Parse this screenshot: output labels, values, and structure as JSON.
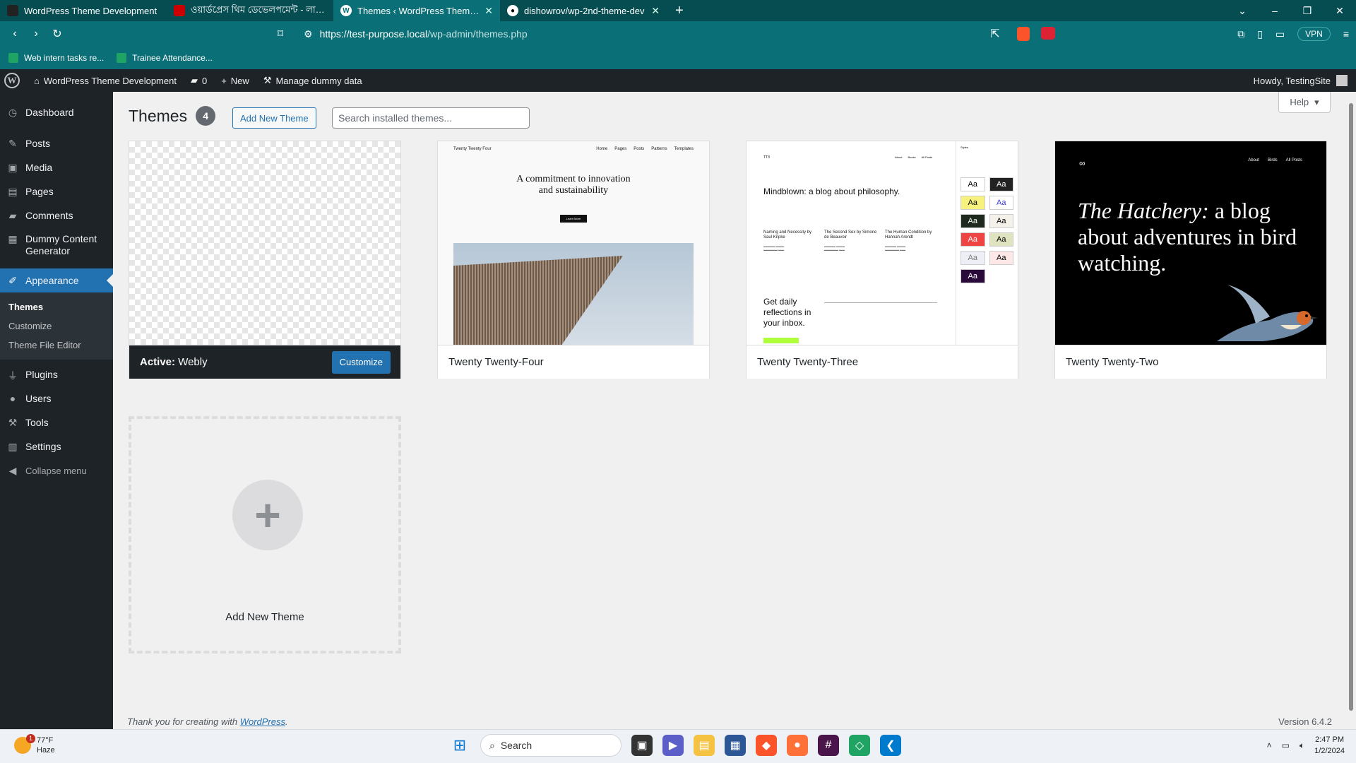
{
  "browser": {
    "tabs": [
      {
        "title": "WordPress Theme Development",
        "active": false
      },
      {
        "title": "ওয়ার্ডপ্রেস থিম ডেভেলপমেন্ট - লার্ন উইথ",
        "active": false
      },
      {
        "title": "Themes ‹ WordPress Theme Dev",
        "active": true
      },
      {
        "title": "dishowrov/wp-2nd-theme-dev",
        "active": false
      }
    ],
    "url_host": "https://test-purpose.local",
    "url_path": "/wp-admin/themes.php",
    "vpn_label": "VPN",
    "bookmarks": [
      "Web intern tasks re...",
      "Trainee Attendance..."
    ]
  },
  "adminbar": {
    "site_name": "WordPress Theme Development",
    "comments_count": "0",
    "new_label": "New",
    "dummy_label": "Manage dummy data",
    "howdy": "Howdy, TestingSite"
  },
  "sidebar": {
    "items": [
      {
        "label": "Dashboard",
        "icon": "dashboard-icon"
      },
      {
        "label": "Posts",
        "icon": "pin-icon"
      },
      {
        "label": "Media",
        "icon": "media-icon"
      },
      {
        "label": "Pages",
        "icon": "page-icon"
      },
      {
        "label": "Comments",
        "icon": "comment-icon"
      },
      {
        "label": "Dummy Content Generator",
        "icon": "generator-icon"
      },
      {
        "label": "Appearance",
        "icon": "brush-icon"
      },
      {
        "label": "Plugins",
        "icon": "plugin-icon"
      },
      {
        "label": "Users",
        "icon": "user-icon"
      },
      {
        "label": "Tools",
        "icon": "wrench-icon"
      },
      {
        "label": "Settings",
        "icon": "settings-icon"
      }
    ],
    "submenu": [
      "Themes",
      "Customize",
      "Theme File Editor"
    ],
    "collapse": "Collapse menu"
  },
  "page": {
    "title": "Themes",
    "count": "4",
    "add_new_button": "Add New Theme",
    "search_placeholder": "Search installed themes...",
    "help": "Help"
  },
  "themes": {
    "active": {
      "prefix": "Active:",
      "name": "Webly",
      "customize": "Customize"
    },
    "tt4": {
      "name": "Twenty Twenty-Four",
      "preview_site": "Twenty Twenty Four",
      "preview_nav": [
        "Home",
        "Pages",
        "Posts",
        "Patterns",
        "Templates"
      ],
      "preview_heading_1": "A commitment to innovation",
      "preview_heading_2": "and sustainability",
      "preview_button": "Learn More"
    },
    "tt3": {
      "name": "Twenty Twenty-Three",
      "preview_site": "TT3",
      "preview_nav": [
        "About",
        "Books",
        "All Posts"
      ],
      "preview_heading": "Mindblown: a blog about philosophy.",
      "preview_posts": [
        {
          "title": "Naming and Necessity by Saul Kripke"
        },
        {
          "title": "The Second Sex by Simone de Beauvoir"
        },
        {
          "title": "The Human Condition by Hannah Arendt"
        }
      ],
      "preview_cta": "Get daily reflections in your inbox.",
      "preview_styles_label": "Styles",
      "preview_swatch": "Aa"
    },
    "tt2": {
      "name": "Twenty Twenty-Two",
      "preview_nav": [
        "About",
        "Birds",
        "All Posts"
      ],
      "preview_heading_em": "The Hatchery:",
      "preview_heading_rest": " a blog about adventures in bird watching."
    }
  },
  "add_new_tile": "Add New Theme",
  "footer": {
    "thanks_prefix": "Thank you for creating with ",
    "thanks_link": "WordPress",
    "thanks_suffix": ".",
    "version": "Version 6.4.2"
  },
  "taskbar": {
    "temp": "77°F",
    "condition": "Haze",
    "search": "Search",
    "time": "2:47 PM",
    "date": "1/2/2024"
  }
}
